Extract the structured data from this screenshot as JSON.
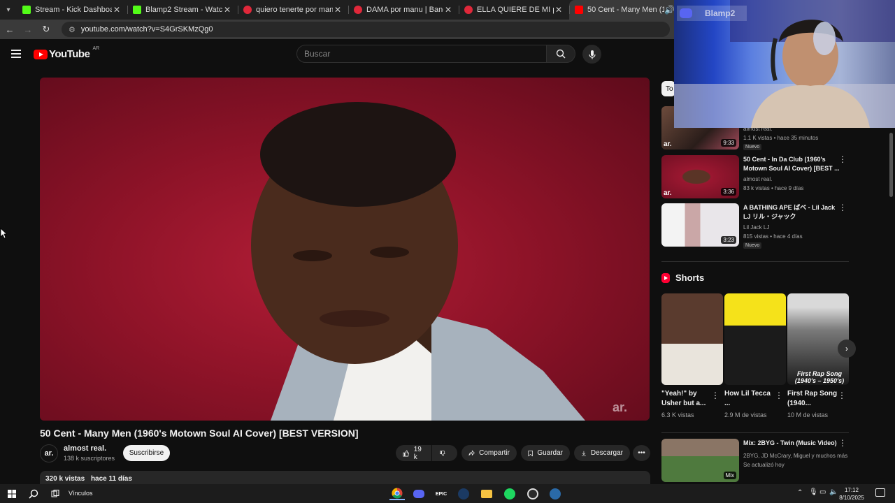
{
  "browser": {
    "tabs": [
      {
        "title": "Stream - Kick Dashboard",
        "favicon_color": "#53fc18",
        "active": false
      },
      {
        "title": "Blamp2 Stream - Watch Live on",
        "favicon_color": "#53fc18",
        "active": false
      },
      {
        "title": "quiero tenerte por manu | Band",
        "favicon_color": "#e0283a",
        "active": false
      },
      {
        "title": "DAMA por manu | BandLab",
        "favicon_color": "#e0283a",
        "active": false
      },
      {
        "title": "ELLA QUIERE DE MI por manu |",
        "favicon_color": "#e0283a",
        "active": false
      },
      {
        "title": "50 Cent - Many Men (1960",
        "favicon_color": "#ff0000",
        "active": true
      }
    ],
    "url": "youtube.com/watch?v=S4GrSKMzQg0"
  },
  "youtube": {
    "logo_text": "YouTube",
    "region": "AR",
    "search_placeholder": "Buscar"
  },
  "video": {
    "title": "50 Cent - Many Men (1960's Motown Soul AI Cover) [BEST VERSION]",
    "watermark": "ar.",
    "channel": {
      "avatar_text": "ar.",
      "name": "almost real.",
      "subscribers": "138 k suscriptores"
    },
    "subscribe_label": "Suscribirse",
    "likes": "19 k",
    "share_label": "Compartir",
    "save_label": "Guardar",
    "download_label": "Descargar",
    "views": "320 k vistas",
    "date": "hace 11 días"
  },
  "sidebar": {
    "chip_label": "To",
    "recommendations": [
      {
        "channel": "almost real.",
        "stats": "1.1 K vistas • hace 35 minutos",
        "duration": "9:33",
        "badge": "Nuevo",
        "thumb_logo": "ar."
      },
      {
        "title": "50 Cent - In Da Club (1960's Motown Soul AI Cover) [BEST ...",
        "channel": "almost real.",
        "stats": "83 k vistas • hace 9 días",
        "duration": "3:36",
        "thumb_logo": "ar."
      },
      {
        "title": "A BATHING APE ばべ - Lil Jack LJ リル・ジャック",
        "channel": "Lil Jack LJ",
        "stats": "815 vistas • hace 4 días",
        "duration": "3:23",
        "badge": "Nuevo"
      }
    ],
    "shorts": {
      "heading": "Shorts",
      "items": [
        {
          "title": "\"Yeah!\" by Usher but a...",
          "views": "6.3 K vistas"
        },
        {
          "title": "How Lil Tecca ...",
          "views": "2.9 M de vistas"
        },
        {
          "title": "First Rap Song (1940...",
          "views": "10 M de vistas",
          "overlay": "First Rap Song (1940's – 1950's)"
        }
      ]
    },
    "mix": {
      "title": "Mix: 2BYG - Twin (Music Video)",
      "artists": "2BYG, JD McCrary, Miguel y muchos más",
      "updated": "Se actualizó hoy",
      "badge": "Mix"
    }
  },
  "overlay": {
    "discord_name": "Blamp2"
  },
  "taskbar": {
    "search_label": "Vínculos",
    "time": "17:12",
    "date": "8/10/2025"
  }
}
